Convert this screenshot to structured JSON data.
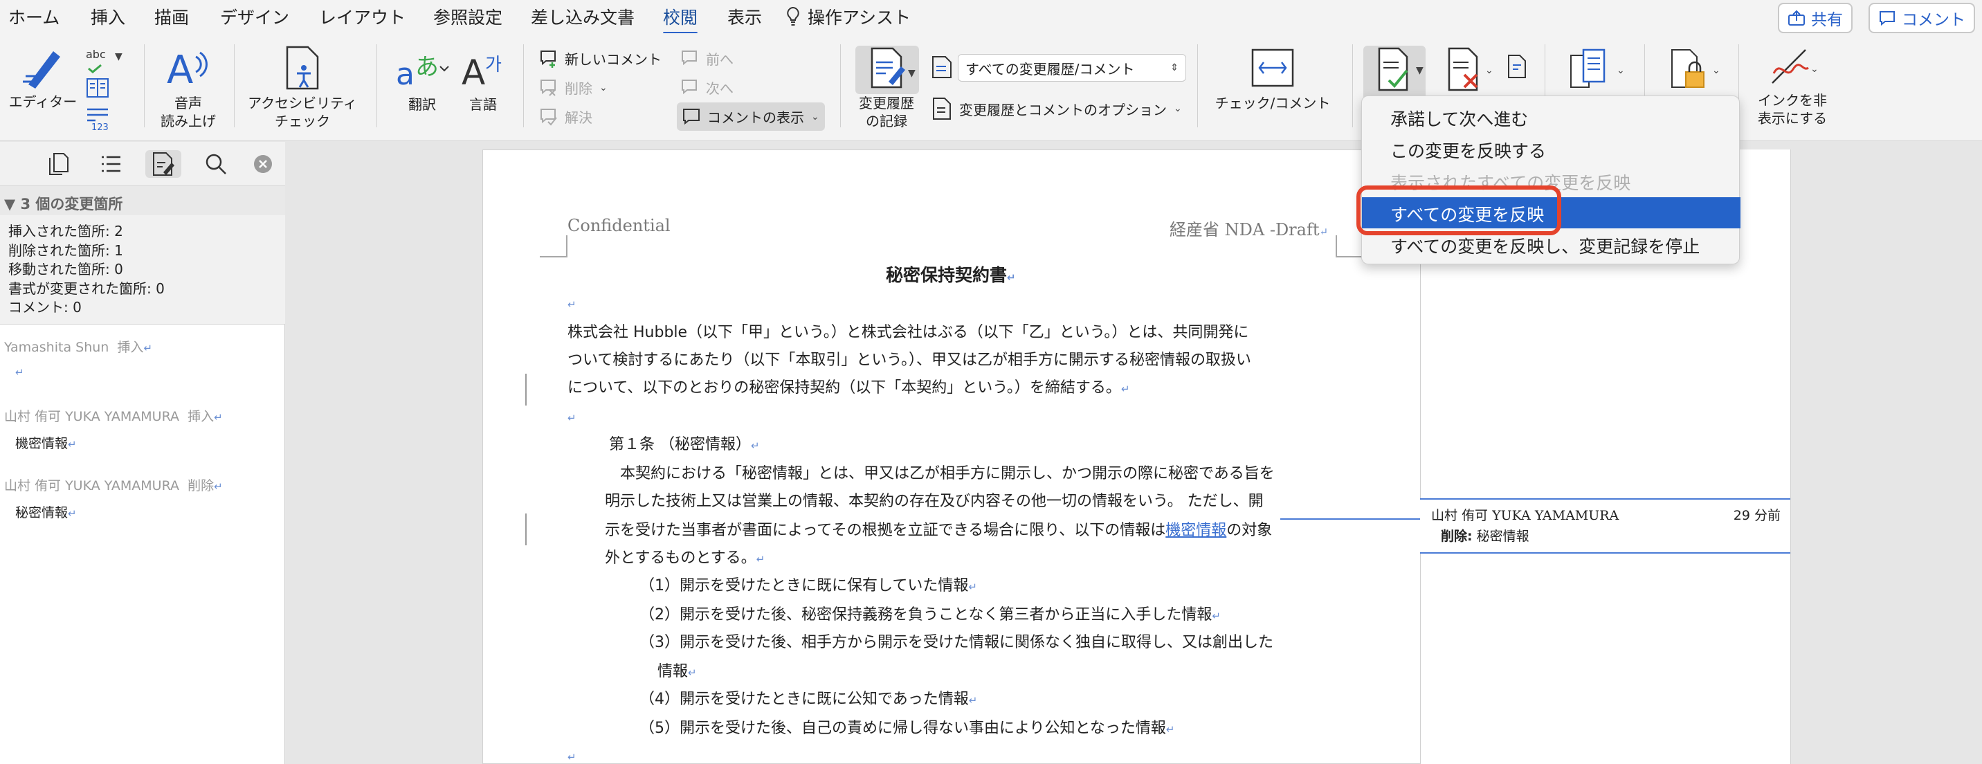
{
  "menu": {
    "tabs": [
      "ホーム",
      "挿入",
      "描画",
      "デザイン",
      "レイアウト",
      "参照設定",
      "差し込み文書",
      "校閲",
      "表示"
    ],
    "active_tab": "校閲",
    "assist": "操作アシスト",
    "share": "共有",
    "comment": "コメント"
  },
  "ribbon": {
    "editor": "エディター",
    "abc": "abc",
    "speech_line1": "音声",
    "speech_line2": "読み上げ",
    "accessibility_line1": "アクセシビリティ",
    "accessibility_line2": "チェック",
    "translate": "翻訳",
    "language": "言語",
    "new_comment": "新しいコメント",
    "delete": "削除",
    "resolve": "解決",
    "previous": "前へ",
    "next": "次へ",
    "show_comments": "コメントの表示",
    "track_line1": "変更履歴",
    "track_line2": "の記録",
    "markup_select": "すべての変更履歴/コメント",
    "markup_options": "変更履歴とコメントのオプション",
    "check_comment": "チェック/コメント",
    "hide_ink_line1": "インクを非",
    "hide_ink_line2": "表示にする"
  },
  "pane": {
    "header": "▼ 3 個の変更箇所",
    "summary": [
      "挿入された箇所: 2",
      "削除された箇所: 1",
      "移動された箇所: 0",
      "書式が変更された箇所: 0",
      "コメント: 0"
    ],
    "revisions": [
      {
        "author": "Yamashita Shun",
        "action": "挿入",
        "text": ""
      },
      {
        "author": "山村 侑可 YUKA YAMAMURA",
        "action": "挿入",
        "text": "機密情報"
      },
      {
        "author": "山村 侑可 YUKA YAMAMURA",
        "action": "削除",
        "text": "秘密情報"
      }
    ]
  },
  "document": {
    "header_left": "Confidential",
    "header_right": "経産省 NDA -Draft",
    "title": "秘密保持契約書",
    "intro": [
      "株式会社 Hubble（以下「甲」という。）と株式会社はぶる（以下「乙」という。）とは、共同開発に",
      "ついて検討するにあたり（以下「本取引」という。）、甲又は乙が相手方に開示する秘密情報の取扱い",
      "について、以下のとおりの秘密保持契約（以下「本契約」という。）を締結する。"
    ],
    "article1_heading": "第１条 （秘密情報）",
    "article1": [
      "本契約における「秘密情報」とは、甲又は乙が相手方に開示し、かつ開示の際に秘密である旨を",
      "明示した技術上又は営業上の情報、本契約の存在及び内容その他一切の情報をいう。 ただし、開",
      "示を受けた当事者が書面によってその根拠を立証できる場合に限り、以下の情報は",
      "外とするものとする。"
    ],
    "inserted_word": "機密情報",
    "after_inserted": "の対象",
    "list": [
      "（1）開示を受けたときに既に保有していた情報",
      "（2）開示を受けた後、秘密保持義務を負うことなく第三者から正当に入手した情報",
      "（3）開示を受けた後、相手方から開示を受けた情報に関係なく独自に取得し、又は創出した",
      "情報",
      "（4）開示を受けたときに既に公知であった情報",
      "（5）開示を受けた後、自己の責めに帰し得ない事由により公知となった情報"
    ]
  },
  "balloon": {
    "author": "山村 侑可 YUKA YAMAMURA",
    "time": "29 分前",
    "label": "削除:",
    "text": "秘密情報"
  },
  "accept_menu": {
    "items": [
      {
        "label": "承諾して次へ進む",
        "state": "normal"
      },
      {
        "label": "この変更を反映する",
        "state": "normal"
      },
      {
        "label": "表示されたすべての変更を反映",
        "state": "disabled"
      },
      {
        "label": "すべての変更を反映",
        "state": "highlighted"
      },
      {
        "label": "すべての変更を反映し、変更記録を停止",
        "state": "normal"
      }
    ]
  },
  "colors": {
    "accent": "#2563c9",
    "highlight_ring": "#e5432c",
    "insert": "#3a6fd0"
  }
}
